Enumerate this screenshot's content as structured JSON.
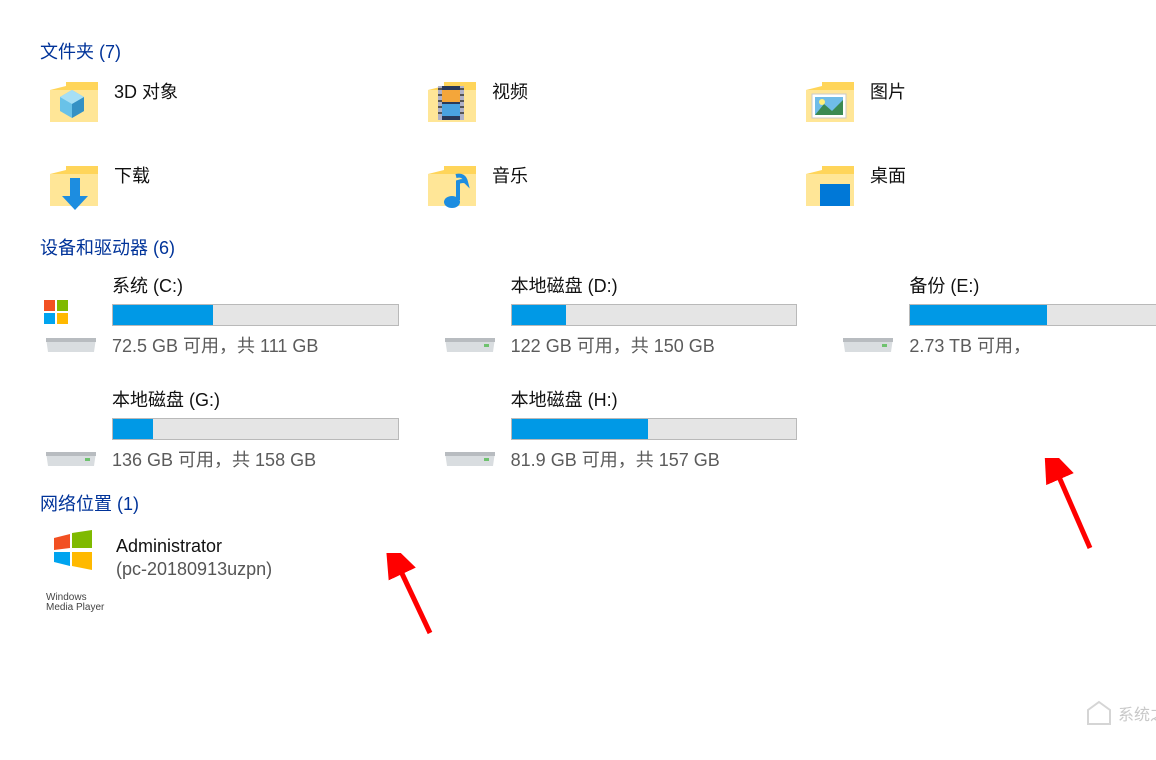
{
  "sections": {
    "folders_header": "文件夹 (7)",
    "drives_header": "设备和驱动器 (6)",
    "network_header": "网络位置 (1)"
  },
  "folders": [
    {
      "name": "3D 对象",
      "icon": "3d"
    },
    {
      "name": "视频",
      "icon": "videos"
    },
    {
      "name": "图片",
      "icon": "pictures"
    },
    {
      "name": "下载",
      "icon": "downloads"
    },
    {
      "name": "音乐",
      "icon": "music"
    },
    {
      "name": "桌面",
      "icon": "desktop"
    }
  ],
  "drives": [
    {
      "name": "系统 (C:)",
      "stats": "72.5 GB 可用，共 111 GB",
      "fill_pct": 35,
      "icon": "windows-drive"
    },
    {
      "name": "本地磁盘 (D:)",
      "stats": "122 GB 可用，共 150 GB",
      "fill_pct": 19,
      "icon": "drive"
    },
    {
      "name": "备份 (E:)",
      "stats": "2.73 TB 可用，",
      "fill_pct": 48,
      "icon": "drive"
    },
    {
      "name": "本地磁盘 (G:)",
      "stats": "136 GB 可用，共 158 GB",
      "fill_pct": 14,
      "icon": "drive"
    },
    {
      "name": "本地磁盘 (H:)",
      "stats": "81.9 GB 可用，共 157 GB",
      "fill_pct": 48,
      "icon": "drive"
    }
  ],
  "network": {
    "main": "Administrator",
    "sub": "(pc-20180913uzpn)",
    "icon_label1": "Windows",
    "icon_label2": "Media Player"
  },
  "watermark": "系统之家"
}
